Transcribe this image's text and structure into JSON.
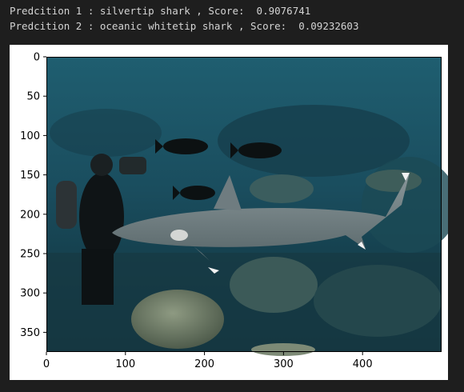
{
  "predictions": [
    {
      "text": "Predcition 1 : silvertip shark , Score:  0.9076741"
    },
    {
      "text": "Predcition 2 : oceanic whitetip shark , Score:  0.09232603"
    }
  ],
  "image": {
    "subject": "shark-photo",
    "colors": {
      "water_top": "#1d5a6c",
      "water_mid": "#194a5a",
      "water_bottom": "#10303a",
      "shark": "#7a8a8e"
    }
  },
  "chart_data": {
    "type": "image",
    "title": "",
    "xlabel": "",
    "ylabel": "",
    "x_ticks": [
      "0",
      "100",
      "200",
      "300",
      "400"
    ],
    "x_tick_values": [
      0,
      100,
      200,
      300,
      400
    ],
    "y_ticks": [
      "0",
      "50",
      "100",
      "150",
      "200",
      "250",
      "300",
      "350"
    ],
    "y_tick_values": [
      0,
      50,
      100,
      150,
      200,
      250,
      300,
      350
    ],
    "xlim": [
      0,
      500
    ],
    "ylim": [
      375,
      0
    ],
    "grid": false
  }
}
